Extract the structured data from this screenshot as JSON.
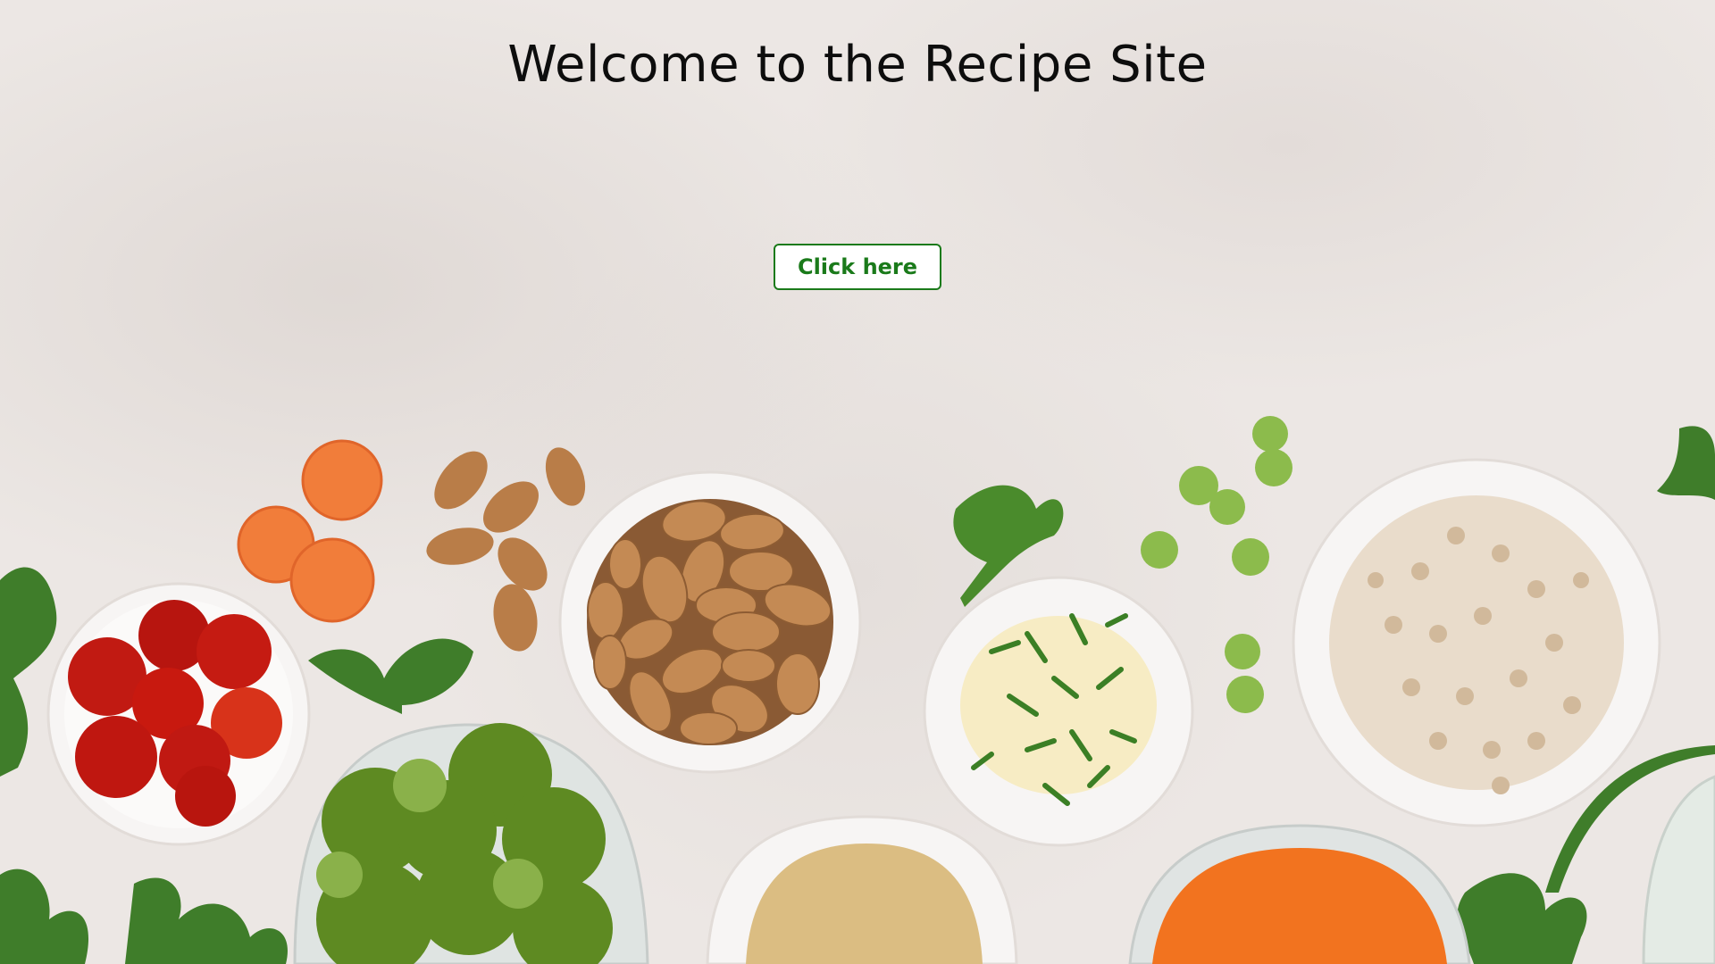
{
  "page": {
    "title": "Welcome to the Recipe Site",
    "cta_label": "Click here"
  },
  "theme": {
    "background": "#ece7e4",
    "title_color": "#0d0d0d",
    "button_border": "#1a7a1a",
    "button_text": "#1a7a1a"
  },
  "background_image": {
    "subject": "overhead ingredients in bowls",
    "items": [
      "tomatoes-bowl",
      "carrot-slices",
      "almonds",
      "almonds-bowl",
      "parsley",
      "mayonnaise-herbs-bowl",
      "green-peas",
      "barley-bowl",
      "broccoli-bowl",
      "ground-spice-bowl",
      "shredded-carrot-bowl",
      "glass-bowl"
    ]
  }
}
